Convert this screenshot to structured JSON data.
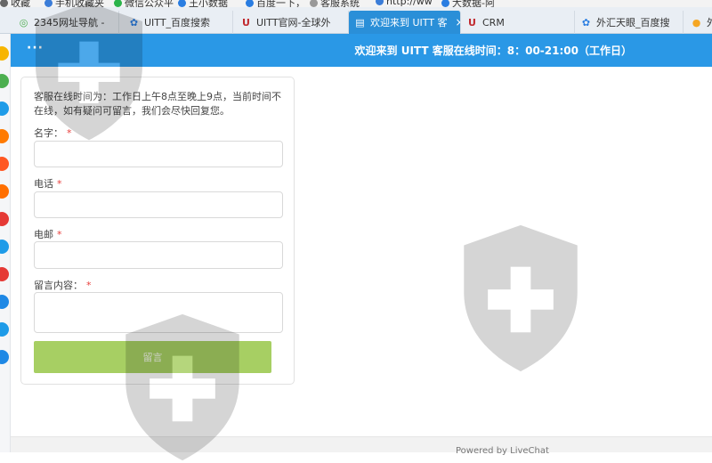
{
  "bookmarks": [
    {
      "label": "收藏",
      "color": "#666666"
    },
    {
      "label": "手机收藏夹",
      "color": "#3b7dd8"
    },
    {
      "label": "微信公众平",
      "color": "#2bb34a"
    },
    {
      "label": "王小数据",
      "color": "#2a7de1"
    },
    {
      "label": "百度一下，",
      "color": "#2a7de1"
    },
    {
      "label": "客服系统",
      "color": "#999999"
    },
    {
      "label": "http://ww",
      "color": "#3b7dd8"
    },
    {
      "label": "大数据-阿",
      "color": "#2a7de1"
    }
  ],
  "tabs": [
    {
      "label": "2345网址导航 -",
      "icon": "globe-icon",
      "icon_glyph": "◎",
      "icon_color": "#4caf50",
      "active": false
    },
    {
      "label": "UITT_百度搜索",
      "icon": "baidu-paw-icon",
      "icon_glyph": "✿",
      "icon_color": "#2a7de1",
      "active": false
    },
    {
      "label": "UITT官网-全球外",
      "icon": "uitt-logo-icon",
      "icon_glyph": "U",
      "icon_color": "#c0282d",
      "active": false
    },
    {
      "label": "欢迎来到 UITT 客",
      "icon": "document-icon",
      "icon_glyph": "▤",
      "icon_color": "#ffffff",
      "active": true,
      "close": "×"
    },
    {
      "label": "CRM",
      "icon": "uitt-logo-icon",
      "icon_glyph": "U",
      "icon_color": "#c0282d",
      "active": false
    },
    {
      "label": "外汇天眼_百度搜",
      "icon": "baidu-paw-icon",
      "icon_glyph": "✿",
      "icon_color": "#2a7de1",
      "active": false
    },
    {
      "label": "外",
      "icon": "sogou-icon",
      "icon_glyph": "●",
      "icon_color": "#f5a623",
      "active": false
    }
  ],
  "sidebar_icons": [
    "#f7b500",
    "#4caf50",
    "#1e9be8",
    "#ff7a00",
    "#ff5722",
    "#ff6f00",
    "#e53935",
    "#1e9be8",
    "#e53935",
    "#1e88e5",
    "#1e9be8",
    "#1e88e5"
  ],
  "header": {
    "menu_icon": "···",
    "title": "欢迎来到 UITT 客服在线时间：8：00-21:00（工作日）"
  },
  "form": {
    "notice": "客服在线时间为：工作日上午8点至晚上9点，当前时间不在线，如有疑问可留言，我们会尽快回复您。",
    "name_label": "名字：",
    "phone_label": "电话",
    "email_label": "电邮",
    "message_label": "留言内容：",
    "required_mark": "*",
    "name_value": "",
    "phone_value": "",
    "email_value": "",
    "message_value": "",
    "submit_label": "留言"
  },
  "footer": {
    "powered_by": "Powered by LiveChat"
  }
}
